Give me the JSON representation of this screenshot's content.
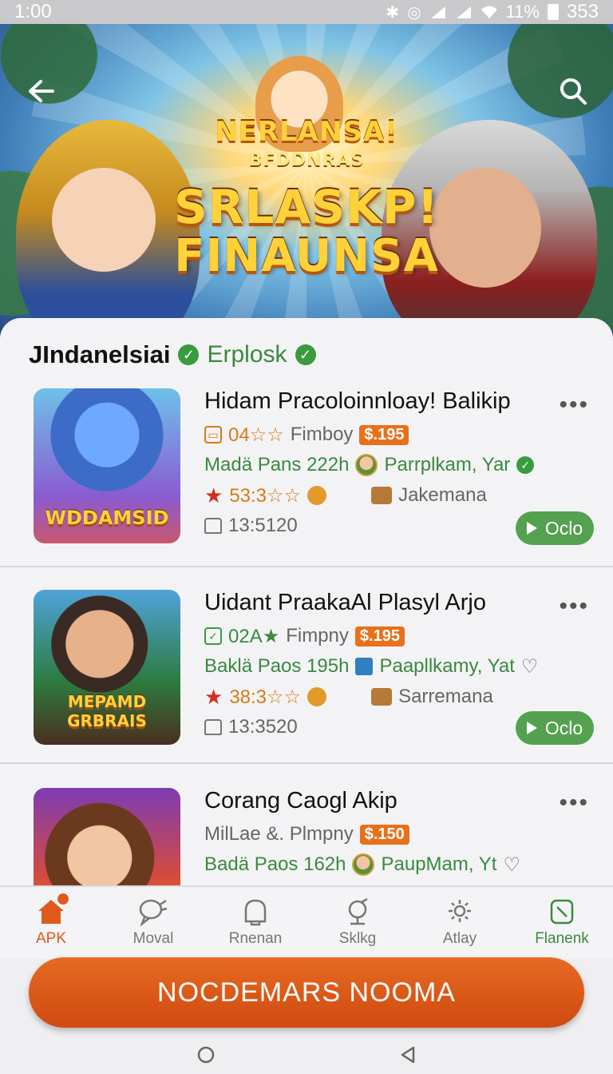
{
  "status_bar": {
    "time": "1:00",
    "battery_text": "11%",
    "battery_level": "353"
  },
  "hero": {
    "title_small": "NERLANSA!",
    "title_small2": "BFDDNRAS",
    "title_big": "SRLASKP!",
    "title_big2": "FINAUNSA"
  },
  "section": {
    "title": "JIndanelsiai",
    "tag": "Erplosk"
  },
  "games": [
    {
      "title": "Hidam Pracoloinnloay! Balikip",
      "thumb_label": "WDDAMSID",
      "rating_code": "04☆☆",
      "publisher": "Fimboy",
      "price": "$.195",
      "meta": "Madä Pans 222h",
      "developer": "Parrplkam, Yar",
      "score": "53:3☆☆",
      "category": "Jakemana",
      "time": "13:5120",
      "action": "Oclo"
    },
    {
      "title": "Uidant PraakaAl Plasyl Arjo",
      "thumb_label": "MEPAMD GRBRAIS",
      "rating_code": "02A★",
      "publisher": "Fimpny",
      "price": "$.195",
      "meta": "Baklä Paos 195h",
      "developer": "Paapllkamy, Yat",
      "score": "38:3☆☆",
      "category": "Sarremana",
      "time": "13:3520",
      "action": "Oclo"
    },
    {
      "title": "Corang Caogl Akip",
      "thumb_label": "",
      "publisher": "MilLae &. Plmpny",
      "price": "$.150",
      "meta": "Badä Paos 162h",
      "developer": "PaupMam, Yt"
    }
  ],
  "nav": [
    {
      "label": "APK",
      "icon": "home-icon"
    },
    {
      "label": "Moval",
      "icon": "chat-icon"
    },
    {
      "label": "Rnenan",
      "icon": "bell-icon"
    },
    {
      "label": "Sklkg",
      "icon": "gamepad-icon"
    },
    {
      "label": "Atlay",
      "icon": "gear-icon"
    },
    {
      "label": "Flanenk",
      "icon": "bookmark-icon"
    }
  ],
  "cta": {
    "label": "NOCDEMARS NOOMA"
  },
  "colors": {
    "accent": "#e05a1c",
    "green": "#54a24f",
    "price": "#e8701b"
  }
}
